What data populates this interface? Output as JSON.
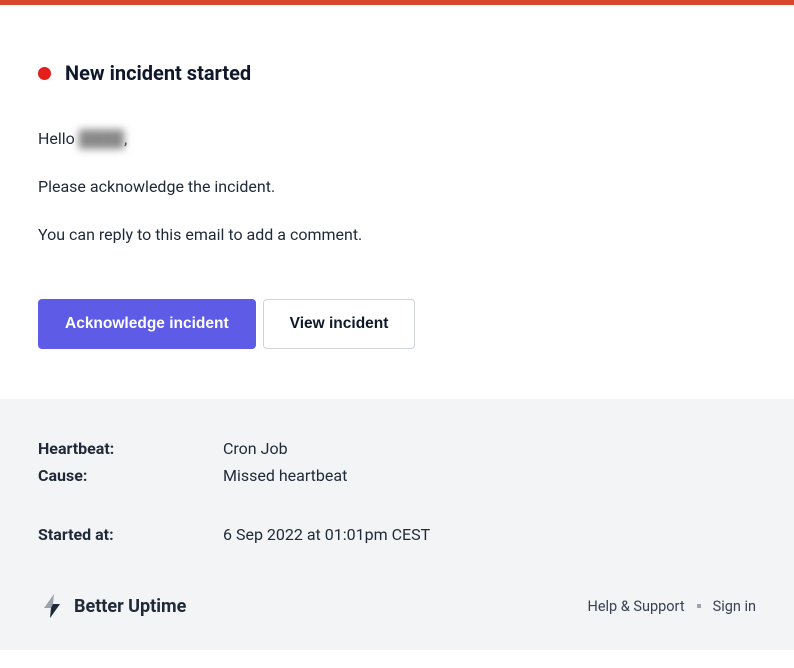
{
  "header": {
    "title": "New incident started"
  },
  "body": {
    "greeting_prefix": "Hello ",
    "greeting_name": "████",
    "greeting_suffix": ",",
    "line1": "Please acknowledge the incident.",
    "line2": "You can reply to this email to add a comment."
  },
  "actions": {
    "acknowledge": "Acknowledge incident",
    "view": "View incident"
  },
  "details": {
    "heartbeat_label": "Heartbeat:",
    "heartbeat_value": "Cron Job",
    "cause_label": "Cause:",
    "cause_value": "Missed heartbeat",
    "started_label": "Started at:",
    "started_value": "6 Sep 2022 at 01:01pm CEST"
  },
  "footer": {
    "brand": "Better Uptime",
    "help": "Help & Support",
    "signin": "Sign in"
  }
}
